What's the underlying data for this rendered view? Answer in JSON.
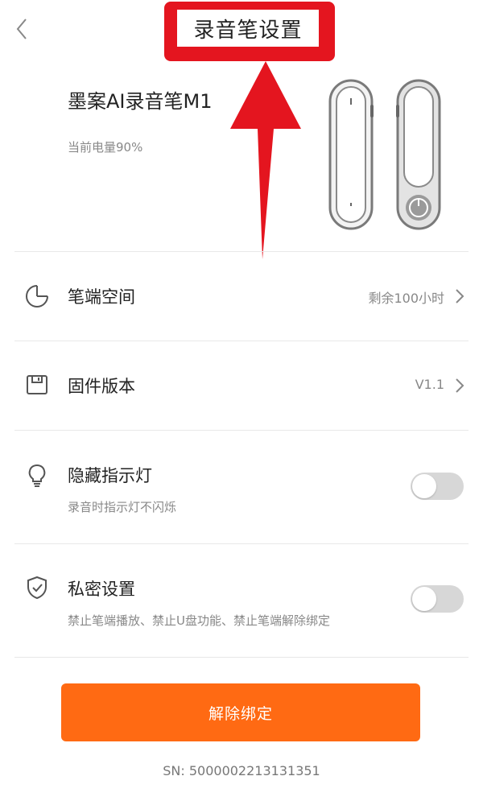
{
  "header": {
    "title": "录音笔设置",
    "back_icon": "chevron-left-icon"
  },
  "device": {
    "name": "墨案AI录音笔M1",
    "battery": "当前电量90%"
  },
  "rows": {
    "storage": {
      "icon": "pie-chart-icon",
      "label": "笔端空间",
      "value": "剩余100小时"
    },
    "firmware": {
      "icon": "floppy-disk-icon",
      "label": "固件版本",
      "value": "V1.1"
    },
    "indicator": {
      "icon": "lightbulb-icon",
      "label": "隐藏指示灯",
      "sub": "录音时指示灯不闪烁",
      "enabled": false
    },
    "privacy": {
      "icon": "shield-check-icon",
      "label": "私密设置",
      "sub": "禁止笔端播放、禁止U盘功能、禁止笔端解除绑定",
      "enabled": false
    }
  },
  "actions": {
    "unbind_label": "解除绑定"
  },
  "footer": {
    "sn": "SN: 5000002213131351"
  },
  "colors": {
    "accent": "#ff6a13",
    "annotation": "#e4151f",
    "toggle_off": "#d7d7d7"
  }
}
